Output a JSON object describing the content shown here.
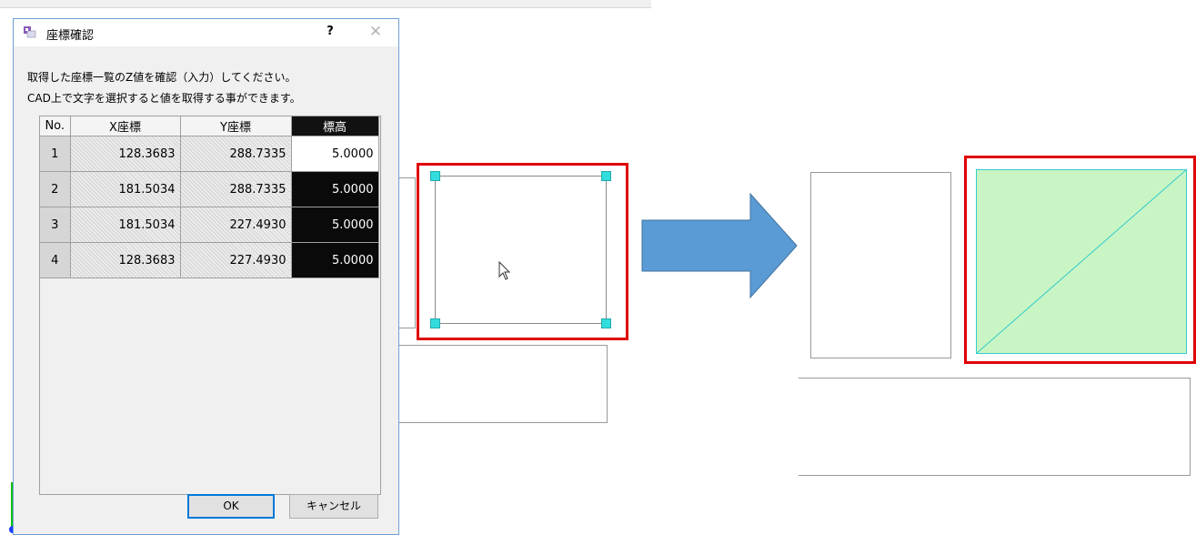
{
  "dialog": {
    "title": "座標確認",
    "help": "?",
    "close": "✕",
    "instruction_line1": "取得した座標一覧のZ値を確認（入力）してください。",
    "instruction_line2": "CAD上で文字を選択すると値を取得する事ができます。",
    "table": {
      "headers": [
        "No.",
        "X座標",
        "Y座標",
        "標高"
      ],
      "rows": [
        {
          "no": "1",
          "x": "128.3683",
          "y": "288.7335",
          "z": "5.0000"
        },
        {
          "no": "2",
          "x": "181.5034",
          "y": "288.7335",
          "z": "5.0000"
        },
        {
          "no": "3",
          "x": "181.5034",
          "y": "227.4930",
          "z": "5.0000"
        },
        {
          "no": "4",
          "x": "128.3683",
          "y": "227.4930",
          "z": "5.0000"
        }
      ]
    },
    "ok_label": "OK",
    "cancel_label": "キャンセル"
  },
  "colors": {
    "highlight_red": "#e00000",
    "arrow_blue": "#5b9bd5",
    "fill_green": "#c9f5c4",
    "handle_cyan": "#33dddd",
    "dialog_border": "#6e9fd6"
  },
  "icons": [
    "app-icon",
    "help-icon",
    "close-icon",
    "mouse-cursor-icon",
    "right-arrow-icon",
    "axis-icon"
  ]
}
